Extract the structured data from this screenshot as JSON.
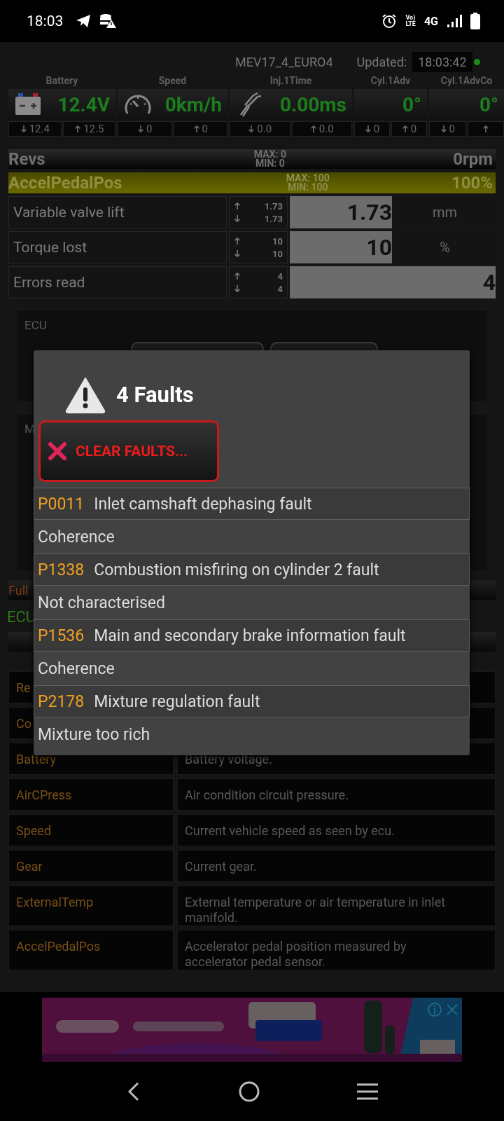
{
  "status_bar": {
    "time": "18:03",
    "volte": [
      "Vo)",
      "LTE"
    ],
    "network": "4G"
  },
  "header": {
    "ecu_name": "MEV17_4_EURO4",
    "updated_label": "Updated:",
    "updated_time": "18:03:42",
    "connected": true
  },
  "gauges": [
    {
      "label": "Battery",
      "value": "12.4V",
      "min": "12.4",
      "max": "12.5"
    },
    {
      "label": "Speed",
      "value": "0km/h",
      "min": "0",
      "max": "0"
    },
    {
      "label": "Inj.1Time",
      "value": "0.00ms",
      "min": "0.0",
      "max": "0.0"
    },
    {
      "label": "Cyl.1Adv",
      "value": "0°",
      "min": "0",
      "max": "0"
    },
    {
      "label": "Cyl.1AdvCo",
      "value": "0°",
      "min": "0"
    }
  ],
  "bars": [
    {
      "name": "Revs",
      "max": "MAX: 0",
      "min": "MIN: 0",
      "value": "0rpm"
    },
    {
      "name": "AccelPedalPos",
      "max": "MAX: 100",
      "min": "MIN: 100",
      "value": "100%",
      "level": 1
    }
  ],
  "readings": [
    {
      "name": "Variable valve lift",
      "max": "1.73",
      "min": "1.73",
      "value": "1.73",
      "unit": "mm"
    },
    {
      "name": "Torque lost",
      "max": "10",
      "min": "10",
      "value": "10",
      "unit": "%"
    },
    {
      "name": "Errors read",
      "max": "4",
      "min": "4",
      "value": "4"
    }
  ],
  "panels": [
    {
      "title": "ECU",
      "kind": "buttons"
    },
    {
      "title": "M",
      "kind": "plain"
    }
  ],
  "section": {
    "title": "Full",
    "subtitle": "ECU"
  },
  "table": {
    "rows": [
      {
        "name": "Re"
      },
      {
        "name": "Co"
      },
      {
        "name": "Battery",
        "description": "Battery voltage."
      },
      {
        "name": "AirCPress",
        "description": "Air condition circuit pressure."
      },
      {
        "name": "Speed",
        "description": "Current vehicle speed as seen by ecu."
      },
      {
        "name": "Gear",
        "description": "Current gear."
      },
      {
        "name": "ExternalTemp",
        "description": "External temperature or air temperature in inlet manifold."
      },
      {
        "name": "AccelPedalPos",
        "description": "Accelerator pedal position measured by accelerator pedal sensor."
      }
    ]
  },
  "dialog": {
    "title": "4 Faults",
    "clear_button": "CLEAR FAULTS...",
    "faults": [
      {
        "code": "P0011",
        "title": "Inlet camshaft dephasing fault",
        "detail": "Coherence"
      },
      {
        "code": "P1338",
        "title": "Combustion misfiring on cylinder 2 fault",
        "detail": "Not characterised"
      },
      {
        "code": "P1536",
        "title": "Main and secondary brake information fault",
        "detail": "Coherence"
      },
      {
        "code": "P2178",
        "title": "Mixture regulation fault",
        "detail": "Mixture too rich"
      }
    ]
  }
}
